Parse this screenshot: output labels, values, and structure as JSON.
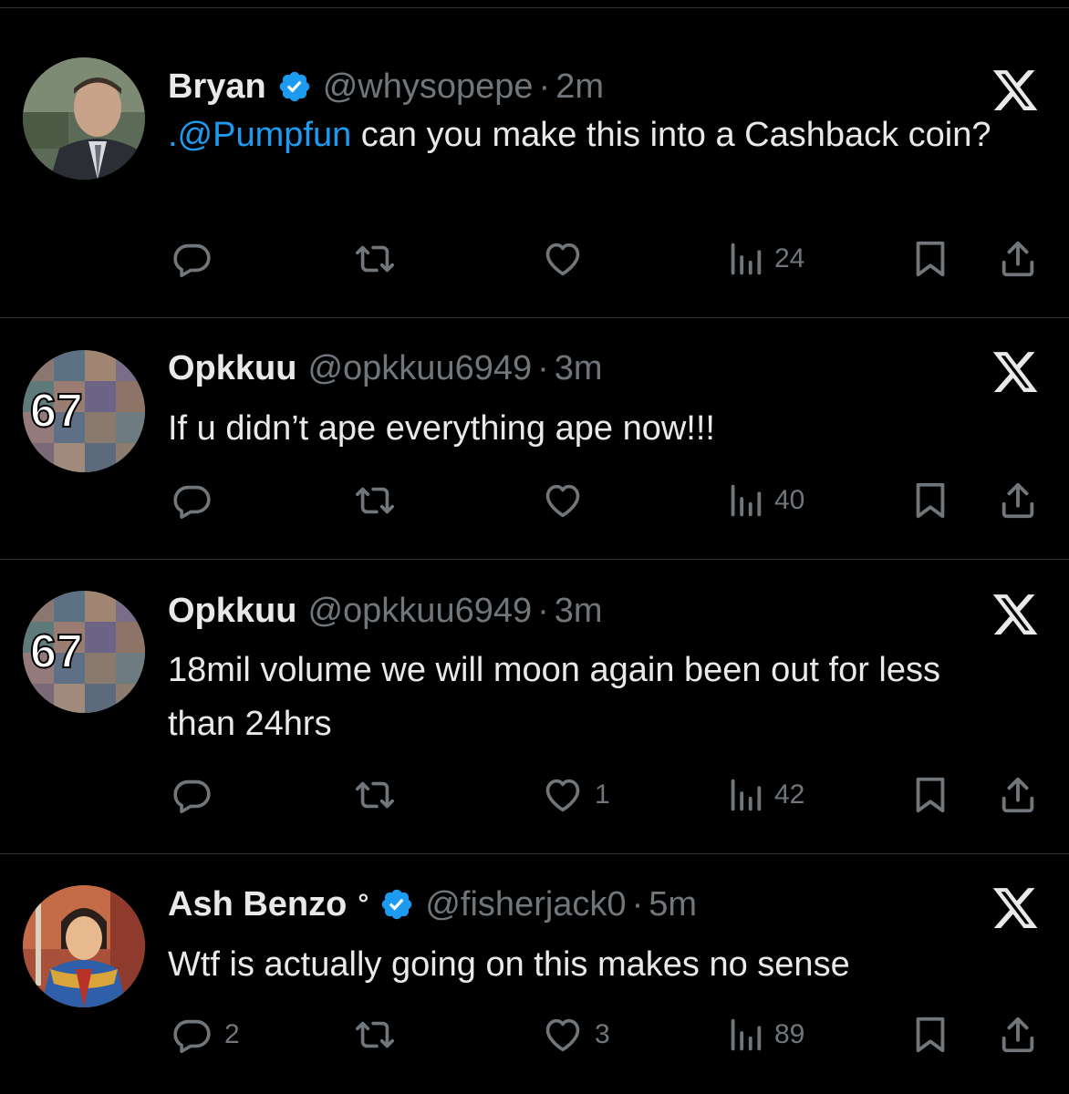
{
  "colors": {
    "background": "#000000",
    "text": "#e7e9ea",
    "muted": "#71767b",
    "mention": "#1d9bf0",
    "verified": "#1d9bf0",
    "divider": "#2f3336"
  },
  "icons": {
    "reply": "reply-icon",
    "retweet": "retweet-icon",
    "like": "heart-icon",
    "views": "views-icon",
    "bookmark": "bookmark-icon",
    "share": "share-icon",
    "platform": "x-logo-icon",
    "verified": "verified-badge-icon"
  },
  "tweets": [
    {
      "name": "Bryan",
      "verified": true,
      "handle": "@whysopepe",
      "separator": "·",
      "time": "2m",
      "mention": ".@Pumpfun",
      "text": " can you make this into a Cashback coin?",
      "replies": "",
      "retweets": "",
      "likes": "",
      "views": "24"
    },
    {
      "name": "Opkkuu",
      "verified": false,
      "handle": "@opkkuu6949",
      "separator": "·",
      "time": "3m",
      "avatar_badge": "67",
      "text": "If u didn’t ape everything ape now!!!",
      "replies": "",
      "retweets": "",
      "likes": "",
      "views": "40"
    },
    {
      "name": "Opkkuu",
      "verified": false,
      "handle": "@opkkuu6949",
      "separator": "·",
      "time": "3m",
      "avatar_badge": "67",
      "text": "18mil volume we will moon again been out for less than 24hrs",
      "replies": "",
      "retweets": "",
      "likes": "1",
      "views": "42"
    },
    {
      "name": "Ash Benzo",
      "name_suffix": "°",
      "verified": true,
      "handle": "@fisherjack0",
      "separator": "·",
      "time": "5m",
      "text": "Wtf is actually going on this makes no sense",
      "replies": "2",
      "retweets": "",
      "likes": "3",
      "views": "89"
    }
  ]
}
